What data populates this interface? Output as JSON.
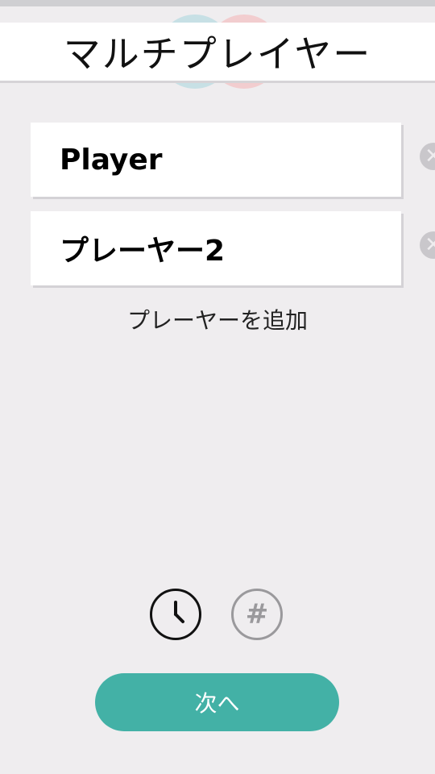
{
  "header": {
    "title": "マルチプレイヤー"
  },
  "players": [
    {
      "name": "Player",
      "remove_icon": "close-circle-icon"
    },
    {
      "name": "プレーヤー2",
      "remove_icon": "close-circle-icon"
    }
  ],
  "add_player_label": "プレーヤーを追加",
  "modes": [
    {
      "icon": "clock-icon",
      "selected": true
    },
    {
      "icon": "hash-icon",
      "selected": false
    }
  ],
  "mode_hash_glyph": "#",
  "remove_glyph": "✕",
  "next_label": "次へ",
  "colors": {
    "background": "#efedef",
    "accent": "#43b1a6",
    "bubble_teal": "#bfdde3",
    "bubble_pink": "#f2c7c9"
  }
}
